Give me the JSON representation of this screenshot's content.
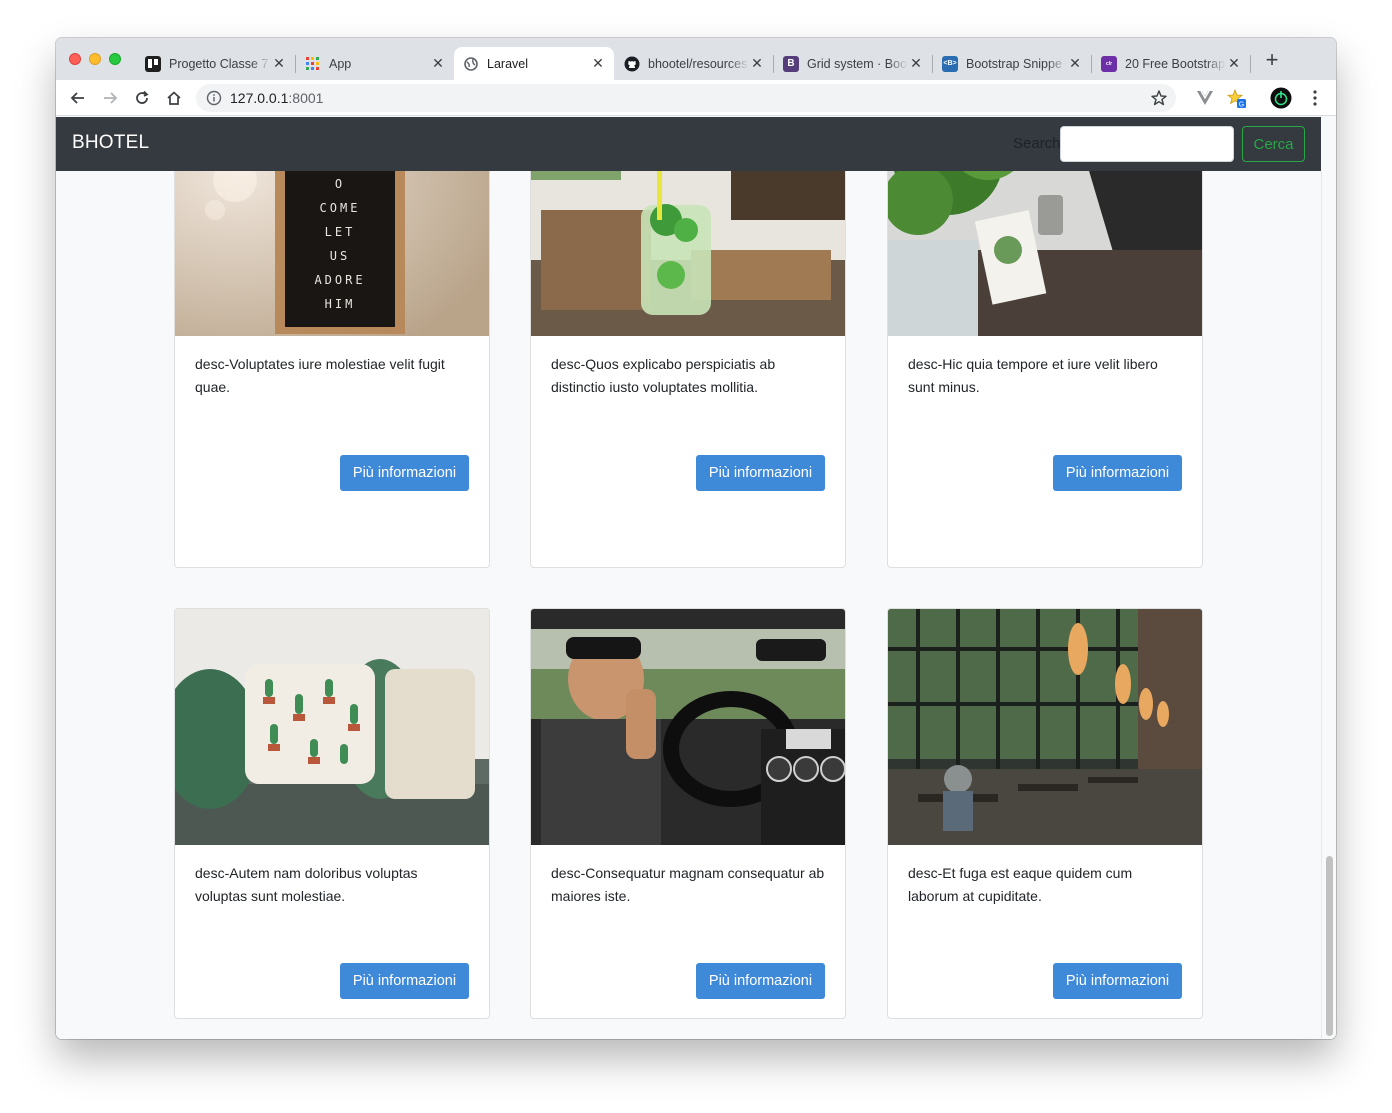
{
  "browser": {
    "tabs": [
      {
        "title": "Progetto Classe 7",
        "favicon": "trello-icon",
        "color": "#1f1f1f"
      },
      {
        "title": "App",
        "favicon": "apps-grid-icon",
        "color": "#ea4335"
      },
      {
        "title": "Laravel",
        "favicon": "globe-icon",
        "color": "#3c4043",
        "active": true
      },
      {
        "title": "bhootel/resources",
        "favicon": "github-icon",
        "color": "#1b1f23"
      },
      {
        "title": "Grid system · Boo",
        "favicon": "bootstrap-icon",
        "color": "#563d7c"
      },
      {
        "title": "Bootstrap Snippe",
        "favicon": "bootsnipp-icon",
        "color": "#2a6db0"
      },
      {
        "title": "20 Free Bootstrap",
        "favicon": "colorlib-icon",
        "color": "#6c2fa8"
      }
    ],
    "url_host": "127.0.0.1",
    "url_port": ":8001",
    "close_glyph": "✕",
    "new_tab_glyph": "+"
  },
  "navbar": {
    "brand": "BHOTEL",
    "search_label": "Search",
    "search_button": "Cerca",
    "brand_bg": "#343a40",
    "accent": "#28a745"
  },
  "cards": [
    {
      "description": "desc-Voluptates iure molestiae velit fugit quae.",
      "button": "Più informazioni",
      "image": "letter-board-photo"
    },
    {
      "description": "desc-Quos explicabo perspiciatis ab distinctio iusto voluptates mollitia.",
      "button": "Più informazioni",
      "image": "mojito-drink-photo"
    },
    {
      "description": "desc-Hic quia tempore et iure velit libero sunt minus.",
      "button": "Più informazioni",
      "image": "potted-plant-photo"
    },
    {
      "description": "desc-Autem nam doloribus voluptas voluptas sunt molestiae.",
      "button": "Più informazioni",
      "image": "cactus-pillow-photo"
    },
    {
      "description": "desc-Consequatur magnam consequatur ab maiores iste.",
      "button": "Più informazioni",
      "image": "car-driver-photo"
    },
    {
      "description": "desc-Et fuga est eaque quidem cum laborum at cupiditate.",
      "button": "Più informazioni",
      "image": "restaurant-interior-photo"
    }
  ],
  "colors": {
    "button_primary": "#3f8ad8",
    "page_bg": "#f8f9fa"
  }
}
